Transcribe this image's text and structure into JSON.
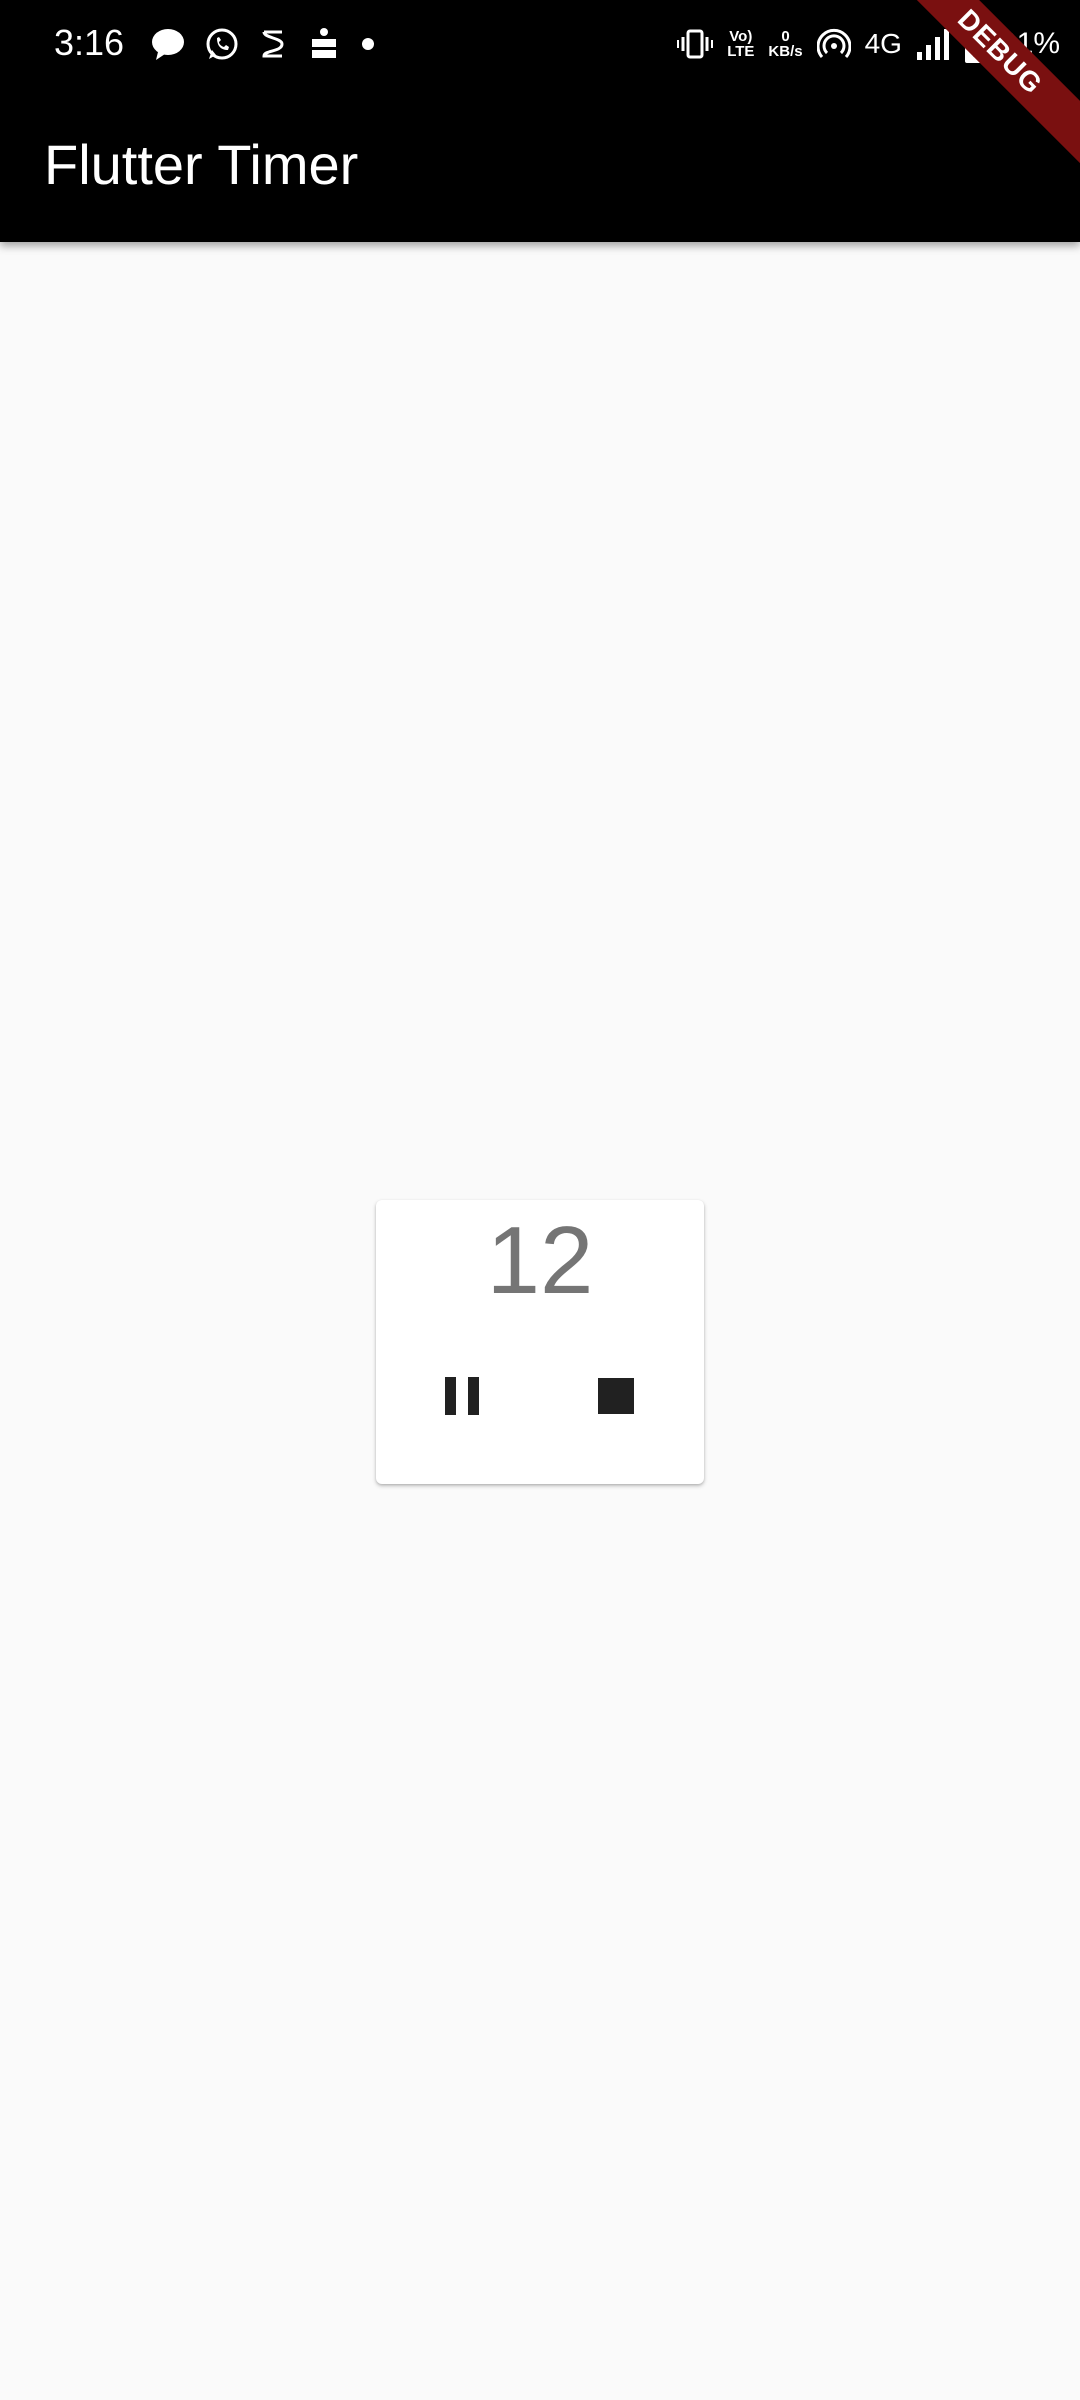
{
  "status_bar": {
    "time": "3:16",
    "network_speed_value": "0",
    "network_speed_unit": "KB/s",
    "volte_top": "Vo)",
    "volte_bottom": "LTE",
    "network_type": "4G",
    "battery_percent": "91%",
    "icons": [
      "message-icon",
      "whatsapp-icon",
      "notification-app-icon",
      "news-app-icon",
      "dot-icon",
      "vibrate-icon",
      "volte-icon",
      "hotspot-icon",
      "signal-icon",
      "battery-charging-icon"
    ]
  },
  "app_bar": {
    "title": "Flutter Timer",
    "background": "#000000"
  },
  "debug_banner": {
    "label": "DEBUG",
    "color": "#7a1010"
  },
  "timer": {
    "value": "12",
    "pause_icon": "pause-icon",
    "stop_icon": "stop-icon"
  }
}
